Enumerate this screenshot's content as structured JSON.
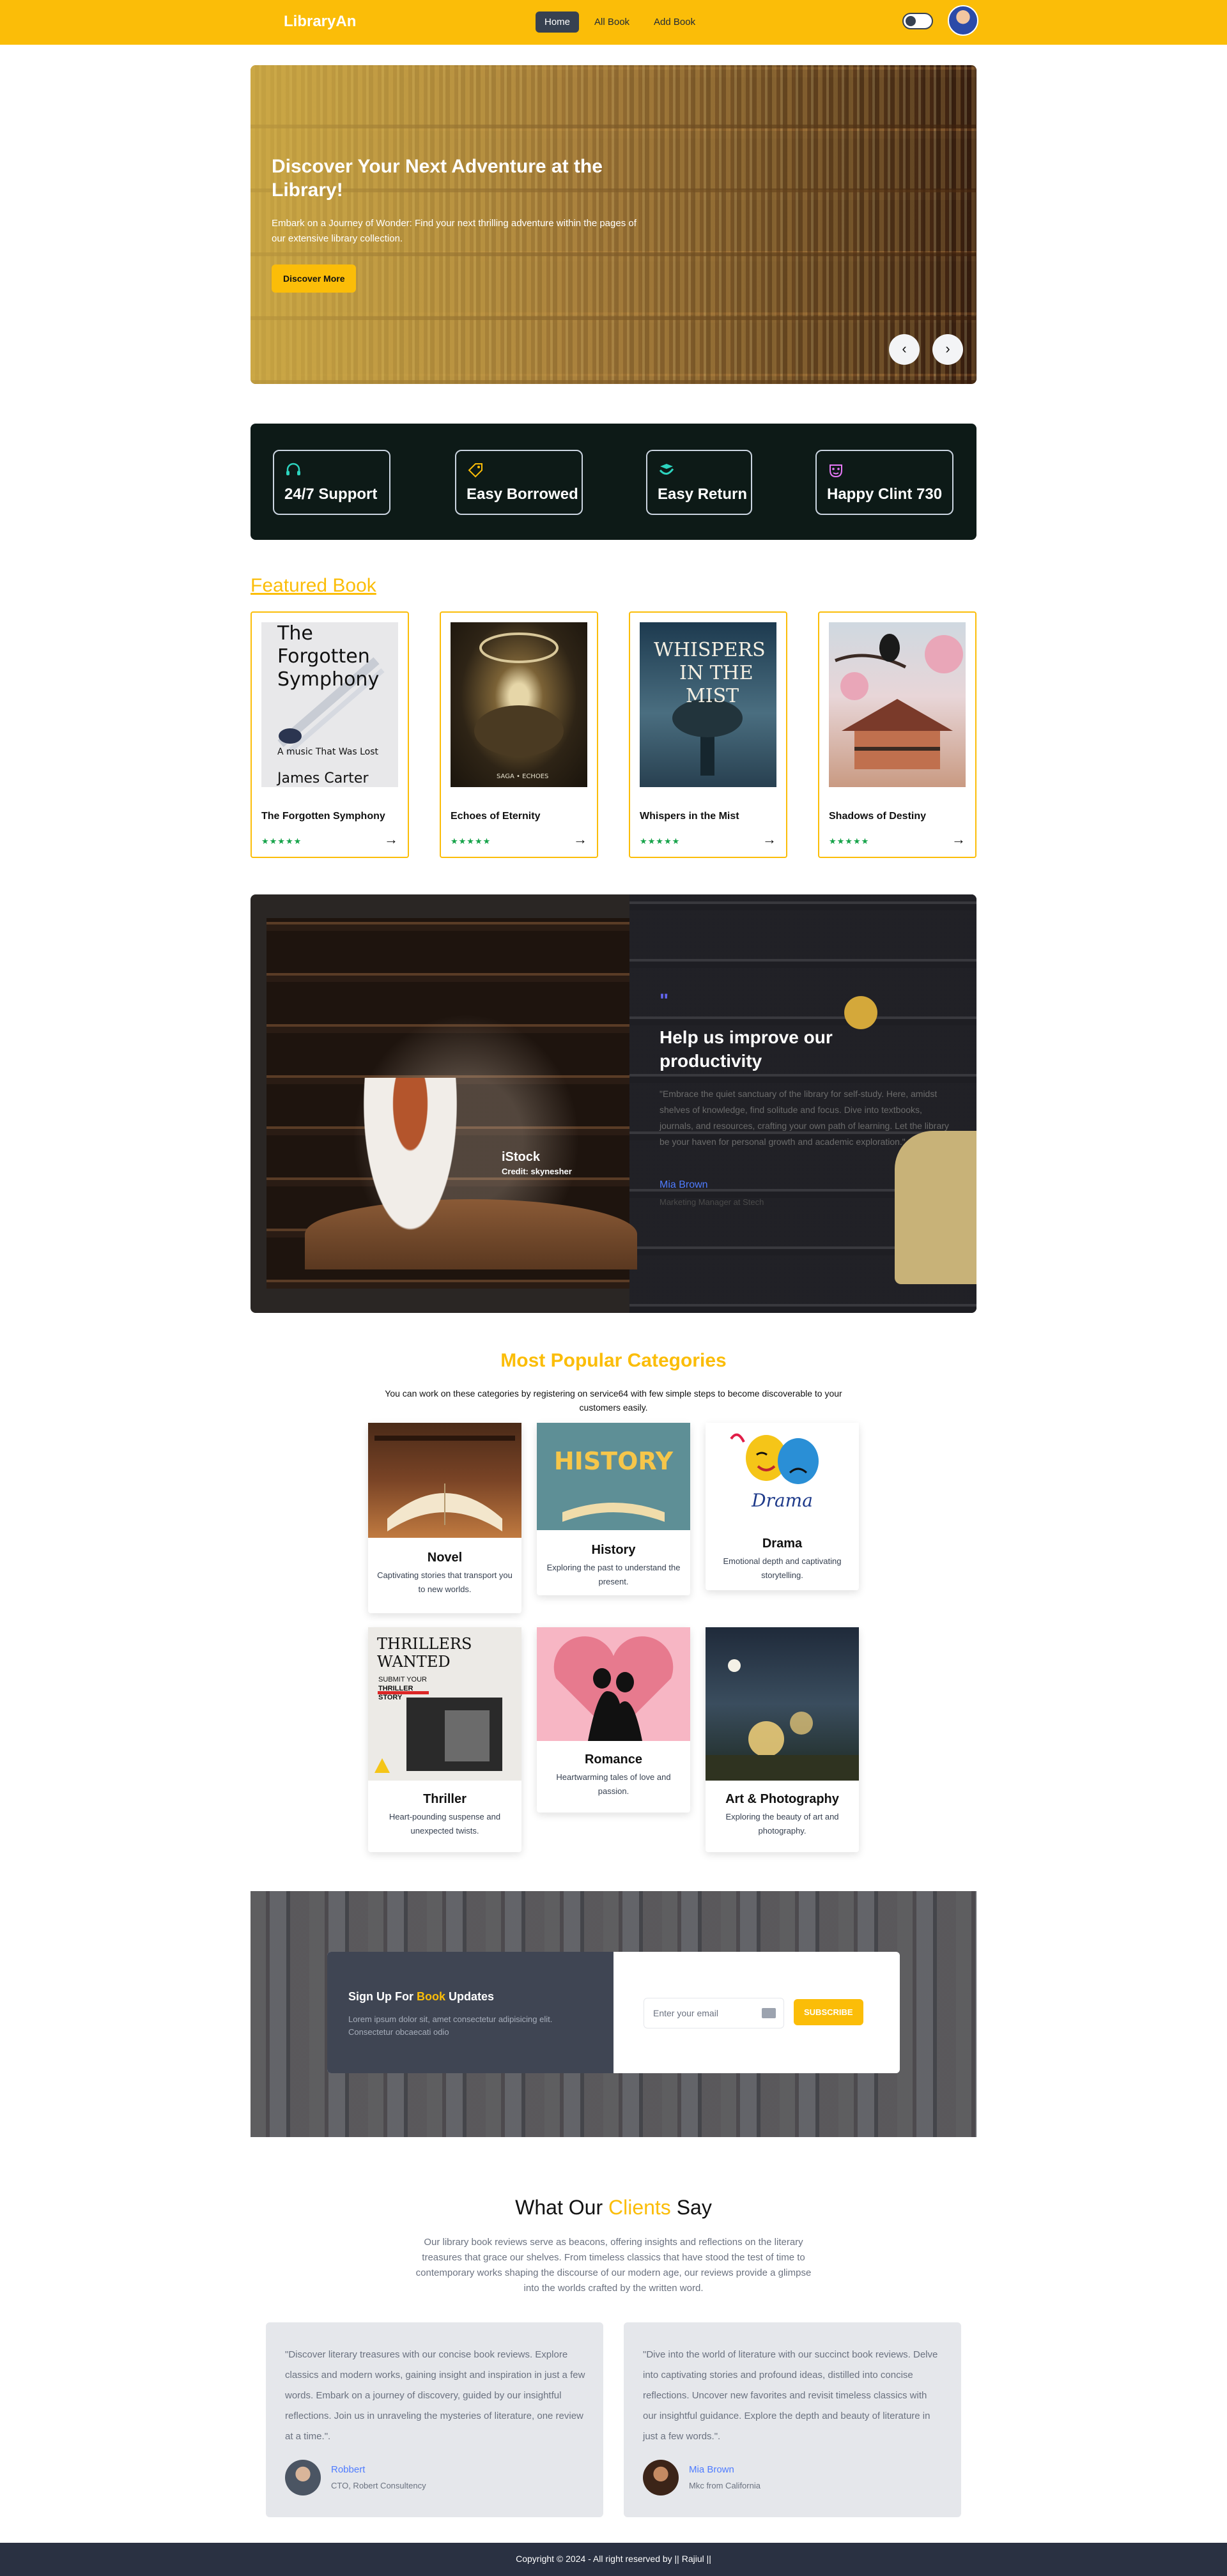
{
  "nav": {
    "brand": "LibraryAn",
    "links": [
      "Home",
      "All Book",
      "Add Book"
    ]
  },
  "hero": {
    "title": "Discover Your Next Adventure at the Library!",
    "text": "Embark on a Journey of Wonder: Find your next thrilling adventure within the pages of our extensive library collection.",
    "button": "Discover More",
    "prev": "‹",
    "next": "›"
  },
  "features": [
    {
      "label": "24/7 Support",
      "icon": "headset-icon"
    },
    {
      "label": "Easy Borrowed",
      "icon": "tag-icon"
    },
    {
      "label": "Easy Return",
      "icon": "return-icon"
    },
    {
      "label": "Happy Clint 730",
      "icon": "mask-icon"
    }
  ],
  "featured": {
    "title": "Featured Book",
    "books": [
      {
        "title": "The Forgotten Symphony",
        "stars": "★★★★★",
        "cover_lines": [
          "The",
          "Forgotten",
          "Symphony",
          "A music That Was Lost",
          "James Carter"
        ]
      },
      {
        "title": "Echoes of Eternity",
        "stars": "★★★★★",
        "cover_lines": [
          "SAGA • ECHOES"
        ]
      },
      {
        "title": "Whispers in the Mist",
        "stars": "★★★★★",
        "cover_lines": [
          "WHISPERS",
          "IN THE",
          "MIST"
        ]
      },
      {
        "title": "Shadows of Destiny",
        "stars": "★★★★★",
        "cover_lines": []
      }
    ]
  },
  "banner": {
    "credit_name": "iStock",
    "credit_sub": "Credit: skynesher",
    "quote_mark": "\"",
    "heading": "Help us improve our productivity",
    "quote": "\"Embrace the quiet sanctuary of the library for self-study. Here, amidst shelves of knowledge, find solitude and focus. Dive into textbooks, journals, and resources, crafting your own path of learning. Let the library be your haven for personal growth and academic exploration.\"",
    "author": "Mia Brown",
    "role": "Marketing Manager at Stech"
  },
  "categories": {
    "title": "Most Popular Categories",
    "subtitle": "You can work on these categories by registering on service64 with few simple steps to become discoverable to your customers easily.",
    "items": [
      {
        "name": "Novel",
        "desc": "Captivating stories that transport you to new worlds."
      },
      {
        "name": "History",
        "desc": "Exploring the past to understand the present."
      },
      {
        "name": "Drama",
        "desc": "Emotional depth and captivating storytelling."
      },
      {
        "name": "Thriller",
        "desc": "Heart-pounding suspense and unexpected twists."
      },
      {
        "name": "Romance",
        "desc": "Heartwarming tales of love and passion."
      },
      {
        "name": "Art & Photography",
        "desc": "Exploring the beauty of art and photography."
      }
    ],
    "image_text": {
      "history": "HISTORY",
      "drama": "Drama",
      "thriller": [
        "THRILLERS",
        "WANTED",
        "SUBMIT YOUR",
        "THRILLER",
        "STORY"
      ]
    }
  },
  "subscribe": {
    "title_prefix": "Sign Up For ",
    "title_highlight": "Book",
    "title_suffix": " Updates",
    "text": "Lorem ipsum dolor sit, amet consectetur adipisicing elit. Consectetur obcaecati odio",
    "placeholder": "Enter your email",
    "button": "SUBSCRIBE"
  },
  "clients": {
    "title_prefix": "What Our ",
    "title_highlight": "Clients",
    "title_suffix": " Say",
    "text": "Our library book reviews serve as beacons, offering insights and reflections on the literary treasures that grace our shelves. From timeless classics that have stood the test of time to contemporary works shaping the discourse of our modern age, our reviews provide a glimpse into the worlds crafted by the written word.",
    "reviews": [
      {
        "text": "\"Discover literary treasures with our concise book reviews. Explore classics and modern works, gaining insight and inspiration in just a few words. Embark on a journey of discovery, guided by our insightful reflections. Join us in unraveling the mysteries of literature, one review at a time.\".",
        "name": "Robbert",
        "role": "CTO, Robert Consultency"
      },
      {
        "text": "\"Dive into the world of literature with our succinct book reviews. Delve into captivating stories and profound ideas, distilled into concise reflections. Uncover new favorites and revisit timeless classics with our insightful guidance. Explore the depth and beauty of literature in just a few words.\".",
        "name": "Mia Brown",
        "role": "Mkc from California"
      }
    ]
  },
  "footer": {
    "text": "Copyright © 2024 - All right reserved by || Rajiul ||"
  }
}
